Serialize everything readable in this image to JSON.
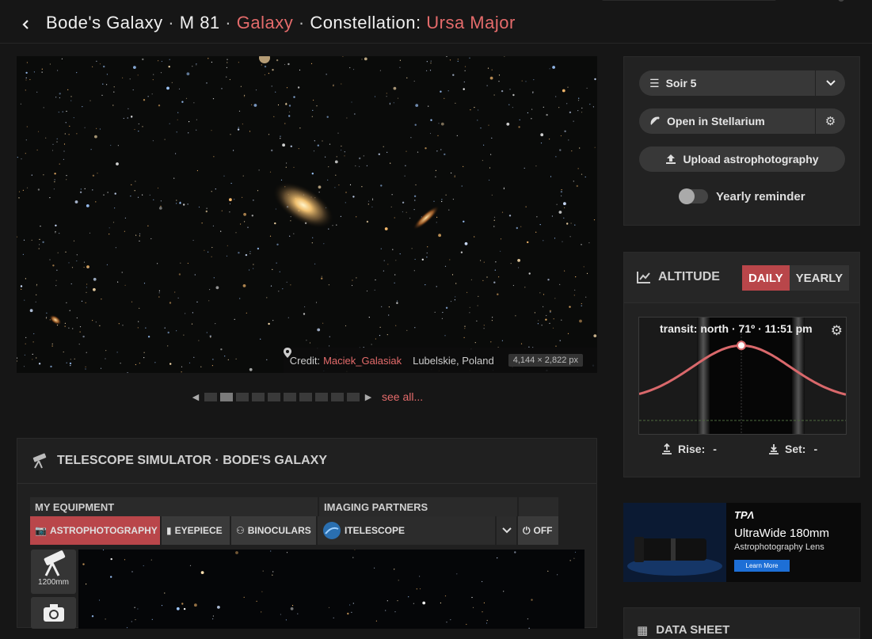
{
  "header": {
    "object_name": "Bode's Galaxy",
    "designation": "M 81",
    "type": "Galaxy",
    "constellation_label": "Constellation:",
    "constellation": "Ursa Major",
    "sep": "·"
  },
  "photo": {
    "credit_label": "Credit:",
    "author": "Maciek_Galasiak",
    "location": "Lubelskie, Poland",
    "dimensions": "4,144 × 2,822 px"
  },
  "gallery": {
    "dot_count": 10,
    "active_index": 1,
    "see_all": "see all..."
  },
  "simulator": {
    "title": "TELESCOPE SIMULATOR · BODE'S GALAXY",
    "my_equipment": "MY EQUIPMENT",
    "imaging_partners": "IMAGING PARTNERS",
    "tabs": {
      "astro": "ASTROPHOTOGRAPHY",
      "eyepiece": "EYEPIECE",
      "binoculars": "BINOCULARS"
    },
    "partner": "ITELESCOPE",
    "off": "OFF",
    "focal": "1200mm"
  },
  "sidebar": {
    "list_name": "Soir 5",
    "stellarium": "Open in Stellarium",
    "upload": "Upload astrophotography",
    "reminder": "Yearly reminder"
  },
  "altitude": {
    "title": "ALTITUDE",
    "daily": "DAILY",
    "yearly": "YEARLY",
    "transit": "transit: north · 71º · 11:51 pm",
    "rise_label": "Rise:",
    "rise_value": "-",
    "set_label": "Set:",
    "set_value": "-",
    "peak_altitude_deg": 71
  },
  "ad": {
    "brand": "TPɅ",
    "headline": "UltraWide 180mm",
    "subline": "Astrophotography Lens",
    "cta": "Learn More"
  },
  "datasheet": {
    "title": "DATA SHEET"
  },
  "colors": {
    "accent": "#e46b6b",
    "active_button": "#b9464a",
    "curve": "#d9686b"
  }
}
